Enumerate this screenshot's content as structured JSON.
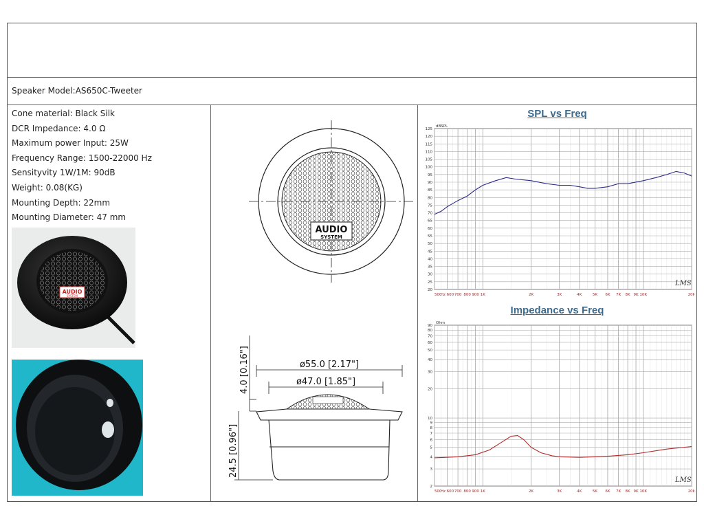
{
  "header": {
    "speaker_model": "Speaker Model:AS650C-Tweeter"
  },
  "specs": [
    "Cone material: Black Silk",
    "DCR Impedance: 4.0 Ω",
    "Maximum power Input: 25W",
    "Frequency Range: 1500-22000 Hz",
    "Sensityvity 1W/1M: 90dB",
    "Weight: 0.08(KG)",
    "Mounting Depth: 22mm",
    "Mounting Diameter: 47 mm"
  ],
  "drawing": {
    "logo_line1": "AUDIO",
    "logo_line2": "SYSTEM",
    "dim_outer": "ø55.0  [2.17\"]",
    "dim_inner": "ø47.0  [1.85\"]",
    "dim_height_top": "4.0  [0.16\"]",
    "dim_height_body": "24.5  [0.96\"]",
    "photo_logo_line1": "AUDIO",
    "photo_logo_line2": "SYSTEM"
  },
  "colors": {
    "spl_line": "#2c2a8a",
    "imp_line": "#b02a2a",
    "title": "#3d6b8e",
    "grid": "#bbbbbb",
    "photo_bg": "#1fb7c9"
  },
  "chart_data": [
    {
      "type": "line",
      "title": "SPL vs Freq",
      "ylabel": "dBSPL",
      "yticks": [
        "125",
        "120",
        "115",
        "110",
        "105",
        "100",
        "95",
        "90",
        "85",
        "80",
        "75",
        "70",
        "65",
        "60",
        "55",
        "50",
        "45",
        "40",
        "35",
        "30",
        "25",
        "20"
      ],
      "ylim": [
        20,
        125
      ],
      "xticks": [
        {
          "f": 500,
          "label": "500"
        },
        {
          "f": 600,
          "label": "Hz 600"
        },
        {
          "f": 700,
          "label": "700"
        },
        {
          "f": 800,
          "label": "800"
        },
        {
          "f": 900,
          "label": "900"
        },
        {
          "f": 1000,
          "label": "1K"
        },
        {
          "f": 2000,
          "label": "2K"
        },
        {
          "f": 3000,
          "label": "3K"
        },
        {
          "f": 4000,
          "label": "4K"
        },
        {
          "f": 5000,
          "label": "5K"
        },
        {
          "f": 6000,
          "label": "6K"
        },
        {
          "f": 7000,
          "label": "7K"
        },
        {
          "f": 8000,
          "label": "8K"
        },
        {
          "f": 9000,
          "label": "9K"
        },
        {
          "f": 10000,
          "label": "10K"
        },
        {
          "f": 20000,
          "label": "20K"
        }
      ],
      "xlim": [
        500,
        20000
      ],
      "x_scale": "log",
      "grid": true,
      "watermark": "LMS",
      "series": [
        {
          "x": [
            500,
            550,
            600,
            700,
            800,
            900,
            1000,
            1200,
            1400,
            1600,
            2000,
            2500,
            3000,
            3500,
            4000,
            4500,
            5000,
            6000,
            7000,
            8000,
            10000,
            12000,
            14000,
            16000,
            18000,
            20000
          ],
          "y": [
            69,
            71,
            74,
            78,
            81,
            85,
            88,
            91,
            93,
            92,
            91,
            89,
            88,
            88,
            87,
            86,
            86,
            87,
            89,
            89,
            91,
            93,
            95,
            97,
            96,
            94
          ]
        }
      ]
    },
    {
      "type": "line",
      "title": "Impedance vs Freq",
      "ylabel": "Ohm",
      "y_scale": "log",
      "yticks": [
        {
          "v": 90,
          "label": "90"
        },
        {
          "v": 80,
          "label": "80"
        },
        {
          "v": 70,
          "label": "70"
        },
        {
          "v": 60,
          "label": "60"
        },
        {
          "v": 50,
          "label": "50"
        },
        {
          "v": 40,
          "label": "40"
        },
        {
          "v": 30,
          "label": "30"
        },
        {
          "v": 20,
          "label": "20"
        },
        {
          "v": 10,
          "label": "10"
        },
        {
          "v": 9,
          "label": "9"
        },
        {
          "v": 8,
          "label": "8"
        },
        {
          "v": 7,
          "label": "7"
        },
        {
          "v": 6,
          "label": "6"
        },
        {
          "v": 5,
          "label": "5"
        },
        {
          "v": 4,
          "label": "4"
        },
        {
          "v": 3,
          "label": "3"
        },
        {
          "v": 2,
          "label": "2"
        }
      ],
      "ylim": [
        2,
        90
      ],
      "xticks": [
        {
          "f": 500,
          "label": "500"
        },
        {
          "f": 600,
          "label": "Hz 600"
        },
        {
          "f": 700,
          "label": "700"
        },
        {
          "f": 800,
          "label": "800"
        },
        {
          "f": 900,
          "label": "900"
        },
        {
          "f": 1000,
          "label": "1K"
        },
        {
          "f": 2000,
          "label": "2K"
        },
        {
          "f": 3000,
          "label": "3K"
        },
        {
          "f": 4000,
          "label": "4K"
        },
        {
          "f": 5000,
          "label": "5K"
        },
        {
          "f": 6000,
          "label": "6K"
        },
        {
          "f": 7000,
          "label": "7K"
        },
        {
          "f": 8000,
          "label": "8K"
        },
        {
          "f": 9000,
          "label": "9K"
        },
        {
          "f": 10000,
          "label": "10K"
        },
        {
          "f": 20000,
          "label": "20K"
        }
      ],
      "xlim": [
        500,
        20000
      ],
      "x_scale": "log",
      "grid": true,
      "watermark": "LMS",
      "series": [
        {
          "x": [
            500,
            700,
            900,
            1100,
            1300,
            1500,
            1650,
            1800,
            2000,
            2300,
            2700,
            3000,
            4000,
            5000,
            6000,
            8000,
            10000,
            14000,
            20000
          ],
          "y": [
            3.9,
            4.0,
            4.2,
            4.7,
            5.6,
            6.5,
            6.6,
            6.0,
            5.0,
            4.4,
            4.1,
            4.0,
            3.95,
            4.0,
            4.05,
            4.2,
            4.4,
            4.8,
            5.1
          ]
        }
      ]
    }
  ]
}
